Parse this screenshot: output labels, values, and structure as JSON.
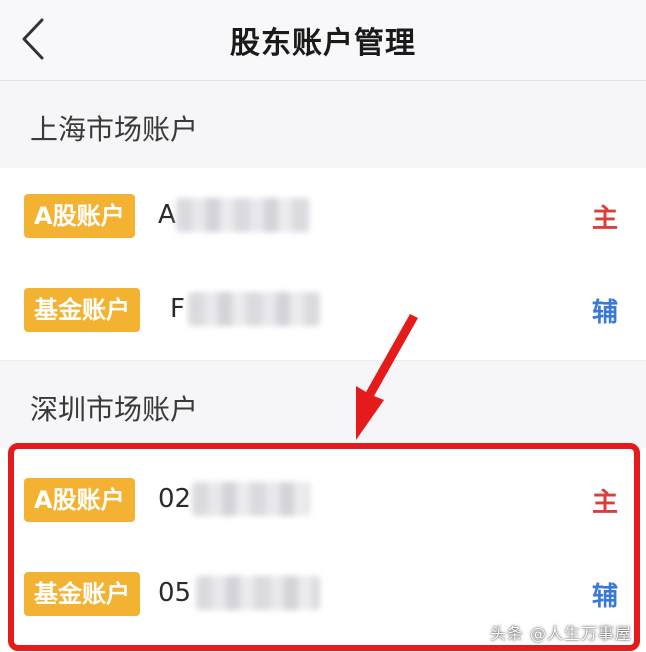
{
  "header": {
    "title": "股东账户管理",
    "back_icon": "chevron-left-icon"
  },
  "shanghai": {
    "section_title": "上海市场账户",
    "accounts": [
      {
        "type_label": "A股账户",
        "number_prefix": "A",
        "role": "主",
        "role_color": "#d9403a"
      },
      {
        "type_label": "基金账户",
        "number_prefix": "F",
        "role": "辅",
        "role_color": "#3a7ad5"
      }
    ]
  },
  "shenzhen": {
    "section_title": "深圳市场账户",
    "accounts": [
      {
        "type_label": "A股账户",
        "number_prefix": "02",
        "role": "主",
        "role_color": "#d9403a"
      },
      {
        "type_label": "基金账户",
        "number_prefix": "05",
        "role": "辅",
        "role_color": "#3a7ad5"
      }
    ]
  },
  "colors": {
    "badge": "#f4b232",
    "highlight": "#e51b1b"
  },
  "watermark": "头条 @人生万事屋"
}
